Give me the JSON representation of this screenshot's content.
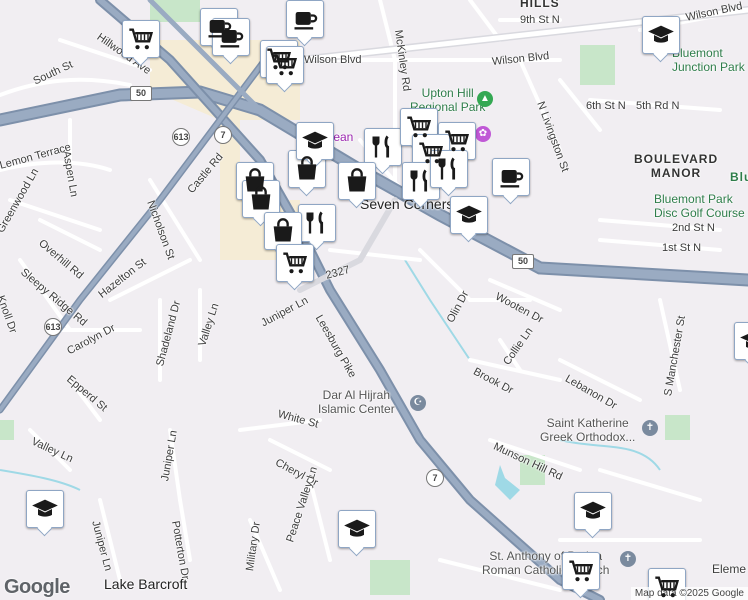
{
  "map": {
    "attribution": "Map data ©2025 Google",
    "logo": "Google",
    "colors": {
      "land": "#f1eef2",
      "road": "#ffffff",
      "highway": "#8b9db5",
      "park": "#c8e6c9",
      "water": "#9fd9e6",
      "commercial": "#f5ecd6",
      "marker_border": "#8fa6c4",
      "icon": "#1a1a1a"
    }
  },
  "road_labels": [
    "Wilson Blvd",
    "Wilson Blvd",
    "Wilson Blvd",
    "South St",
    "Hillwood Ave",
    "Aspen Ln",
    "Castle Rd",
    "Nicholson St",
    "Overhill Rd",
    "Sleepy Ridge Rd",
    "Knoll Dr",
    "Hazelton St",
    "Shadeland Dr",
    "Valley Ln",
    "Juniper Ln",
    "Carolyn Dr",
    "Epperd St",
    "Valley Ln",
    "Juniper Ln",
    "Juniper Ln",
    "Potterton Dr",
    "Leesburg Pike",
    "White St",
    "Cheryl Dr",
    "Peace Valley Ln",
    "Military Dr",
    "McKinley Rd",
    "N Livingston St",
    "6th St N",
    "5th Rd N",
    "9th St N",
    "2nd St N",
    "1st St N",
    "Wooten Dr",
    "Olin Dr",
    "Collie Ln",
    "Brook Dr",
    "Lebanon Dr",
    "S Manchester St",
    "Munson Hill Rd",
    "Lemon Terrace",
    "Greenwood Ln"
  ],
  "places": {
    "upton_hill": "Upton Hill Regional Park",
    "upton_hill_line1": "Upton Hill",
    "upton_hill_line2": "Regional Park",
    "bluemont_junction": "Bluemont Junction Park",
    "bluemont_junction_line1": "Bluemont",
    "bluemont_junction_line2": "Junction Park",
    "boulevard_manor_line1": "BOULEVARD",
    "boulevard_manor_line2": "MANOR",
    "bluemont_park_line1": "Bluemont Park",
    "bluemont_park_line2": "Disc Golf Course",
    "seven_corners": "Seven Corners",
    "ocean": "Ocean",
    "dar_al_hijrah_line1": "Dar Al Hijrah",
    "dar_al_hijrah_line2": "Islamic Center",
    "saint_katherine_line1": "Saint Katherine",
    "saint_katherine_line2": "Greek Orthodox...",
    "st_anthony_line1": "St. Anthony of Padua",
    "st_anthony_line2": "Roman Catholic Church",
    "lake_barcroft": "Lake Barcroft",
    "hills_partial": "HILLS",
    "elem_partial": "Eleme",
    "blu_partial": "Blu"
  },
  "route_shields": [
    "50",
    "50",
    "50",
    "613",
    "613",
    "7",
    "7",
    "2327"
  ],
  "markers": [
    {
      "type": "grocery"
    },
    {
      "type": "cafe"
    },
    {
      "type": "cafe"
    },
    {
      "type": "cafe"
    },
    {
      "type": "grocery"
    },
    {
      "type": "grocery"
    },
    {
      "type": "school"
    },
    {
      "type": "restaurant"
    },
    {
      "type": "grocery"
    },
    {
      "type": "grocery"
    },
    {
      "type": "grocery"
    },
    {
      "type": "restaurant"
    },
    {
      "type": "restaurant"
    },
    {
      "type": "cafe"
    },
    {
      "type": "shopping"
    },
    {
      "type": "shopping"
    },
    {
      "type": "school"
    },
    {
      "type": "shopping"
    },
    {
      "type": "shopping"
    },
    {
      "type": "restaurant"
    },
    {
      "type": "shopping"
    },
    {
      "type": "grocery"
    },
    {
      "type": "school"
    },
    {
      "type": "school"
    },
    {
      "type": "school"
    },
    {
      "type": "grocery"
    },
    {
      "type": "grocery"
    },
    {
      "type": "school"
    },
    {
      "type": "school"
    }
  ]
}
